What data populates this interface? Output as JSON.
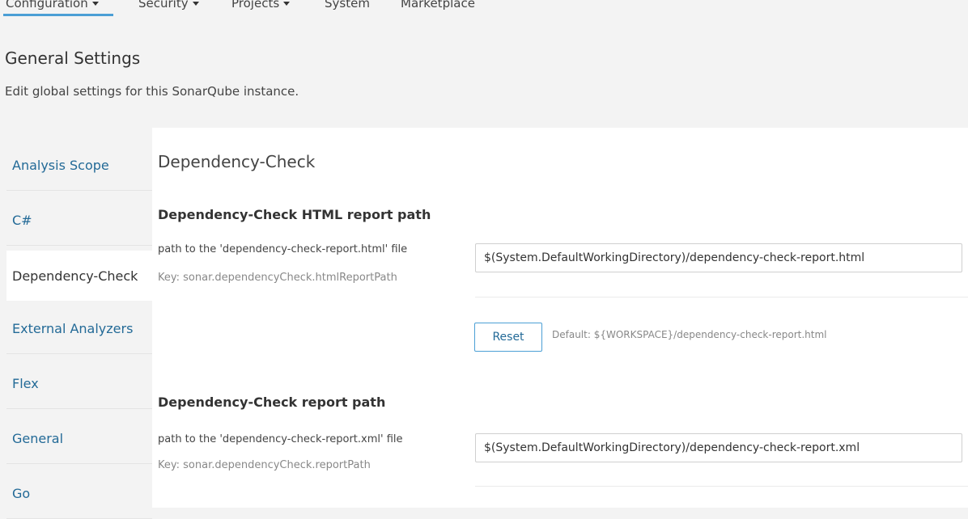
{
  "nav": {
    "items": [
      {
        "label": "Configuration",
        "dropdown": true
      },
      {
        "label": "Security",
        "dropdown": true
      },
      {
        "label": "Projects",
        "dropdown": true
      },
      {
        "label": "System",
        "dropdown": false
      },
      {
        "label": "Marketplace",
        "dropdown": false
      }
    ],
    "active_index": 0
  },
  "header": {
    "title": "General Settings",
    "description": "Edit global settings for this SonarQube instance."
  },
  "sidebar": {
    "items": [
      {
        "label": "Analysis Scope",
        "active": false
      },
      {
        "label": "C#",
        "active": false
      },
      {
        "label": "Dependency-Check",
        "active": true
      },
      {
        "label": "External Analyzers",
        "active": false
      },
      {
        "label": "Flex",
        "active": false
      },
      {
        "label": "General",
        "active": false
      },
      {
        "label": "Go",
        "active": false
      }
    ]
  },
  "main": {
    "section_title": "Dependency-Check",
    "settings": [
      {
        "name": "Dependency-Check HTML report path",
        "description": "path to the 'dependency-check-report.html' file",
        "key": "Key: sonar.dependencyCheck.htmlReportPath",
        "value": "$(System.DefaultWorkingDirectory)/dependency-check-report.html",
        "reset_label": "Reset",
        "default_text": "Default: ${WORKSPACE}/dependency-check-report.html"
      },
      {
        "name": "Dependency-Check report path",
        "description": "path to the 'dependency-check-report.xml' file",
        "key": "Key: sonar.dependencyCheck.reportPath",
        "value": "$(System.DefaultWorkingDirectory)/dependency-check-report.xml"
      }
    ]
  },
  "colors": {
    "link": "#236a97",
    "accent": "#4b9fd5",
    "background": "#f3f3f3",
    "panel": "#ffffff"
  }
}
